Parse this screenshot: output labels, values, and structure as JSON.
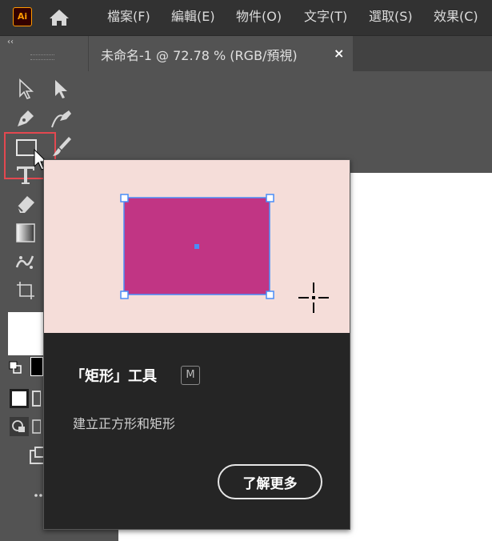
{
  "app": {
    "logo_text": "Ai"
  },
  "menu": {
    "items": [
      "檔案(F)",
      "編輯(E)",
      "物件(O)",
      "文字(T)",
      "選取(S)",
      "效果(C)"
    ]
  },
  "document": {
    "tab_label": "未命名-1 @ 72.78 % (RGB/預視)",
    "close_glyph": "×"
  },
  "toolbar": {
    "collapse_glyph": "‹‹",
    "active_tool": "rectangle-tool"
  },
  "tooltip": {
    "title": "「矩形」工具",
    "shortcut": "M",
    "description": "建立正方形和矩形",
    "learn_more_label": "了解更多",
    "preview_bg": "#f5ddd9",
    "shape_fill": "#c13584",
    "handle_color": "#4a8df8"
  },
  "colors": {
    "highlight": "#e34850"
  }
}
